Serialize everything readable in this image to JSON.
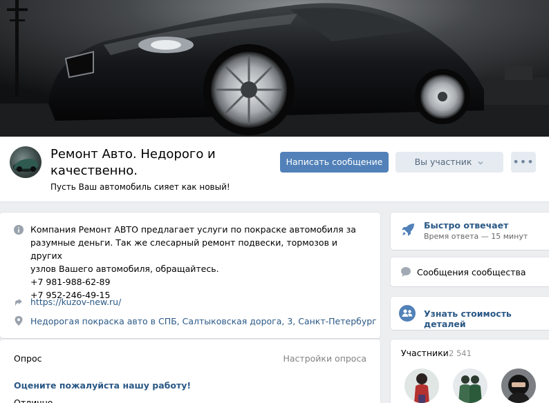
{
  "header": {
    "title": "Ремонт Авто. Недорого и качественно.",
    "status": "Пусть Ваш автомобиль сияет как новый!",
    "message_button": "Написать сообщение",
    "member_button": "Вы участник",
    "more_button": "•••"
  },
  "info": {
    "description_lines": [
      "Компания Ремонт АВТО предлагает услуги по покраске автомобиля за",
      "разумные деньги. Так же слесарный ремонт подвески, тормозов и других",
      "узлов Вашего автомобиля, обращайтесь.",
      "+7 981-988-62-89",
      "+7 952-246-49-15"
    ],
    "website": "https://kuzov-new.ru/",
    "address": "Недорогая покраска авто в СПБ, Салтыковская дорога, 3, Санкт-Петербург"
  },
  "poll": {
    "label": "Опрос",
    "settings": "Настройки опроса",
    "question": "Оцените пожалуйста нашу работу!",
    "first_option": "Отлично"
  },
  "sidebar": {
    "fast_reply_title": "Быстро отвечает",
    "fast_reply_sub": "Время ответа — 15 минут",
    "community_messages": "Сообщения сообщества",
    "price_link": "Узнать стоимость деталей",
    "members_title": "Участники",
    "members_count": "2 541"
  },
  "colors": {
    "accent": "#5181b8",
    "link": "#2a5885",
    "background": "#edeef0"
  },
  "icons": [
    "info-icon",
    "share-icon",
    "location-icon",
    "rocket-icon",
    "chat-icon",
    "people-icon",
    "chevron-down-icon"
  ]
}
